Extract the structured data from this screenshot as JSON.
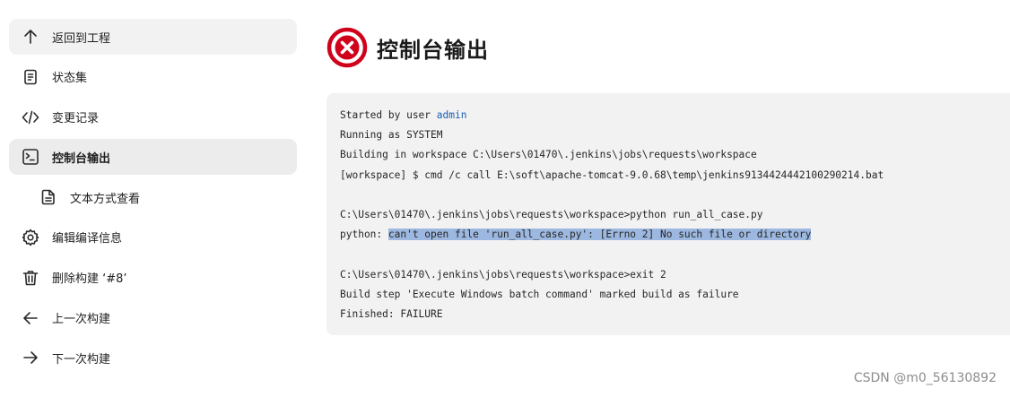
{
  "sidebar": {
    "items": [
      {
        "label": "返回到工程",
        "icon": "arrow-up-icon"
      },
      {
        "label": "状态集",
        "icon": "document-icon"
      },
      {
        "label": "变更记录",
        "icon": "code-icon"
      },
      {
        "label": "控制台输出",
        "icon": "terminal-icon",
        "active": true
      },
      {
        "label": "文本方式查看",
        "icon": "file-icon"
      },
      {
        "label": "编辑编译信息",
        "icon": "gear-icon"
      },
      {
        "label": "删除构建 ‘#8’",
        "icon": "trash-icon"
      },
      {
        "label": "上一次构建",
        "icon": "arrow-left-icon"
      },
      {
        "label": "下一次构建",
        "icon": "arrow-right-icon"
      }
    ]
  },
  "header": {
    "title": "控制台输出",
    "status_icon": "failure-icon",
    "status_color": "#d0021b"
  },
  "console": {
    "started_prefix": "Started by user ",
    "started_user": "admin",
    "line_running": "Running as SYSTEM",
    "line_building": "Building in workspace C:\\Users\\01470\\.jenkins\\jobs\\requests\\workspace",
    "line_cmd": "[workspace] $ cmd /c call E:\\soft\\apache-tomcat-9.0.68\\temp\\jenkins9134424442100290214.bat",
    "line_prompt_python": "C:\\Users\\01470\\.jenkins\\jobs\\requests\\workspace>python run_all_case.py",
    "error_prefix": "python: ",
    "error_message": "can't open file 'run_all_case.py': [Errno 2] No such file or directory",
    "line_prompt_exit": "C:\\Users\\01470\\.jenkins\\jobs\\requests\\workspace>exit 2",
    "line_build_step": "Build step 'Execute Windows batch command' marked build as failure",
    "line_finished": "Finished: FAILURE"
  },
  "watermark": "CSDN @m0_56130892",
  "colors": {
    "link": "#1a5fb4",
    "selection_highlight": "#9db8e0",
    "console_bg": "#f2f2f2",
    "active_nav_bg": "#ececec"
  }
}
